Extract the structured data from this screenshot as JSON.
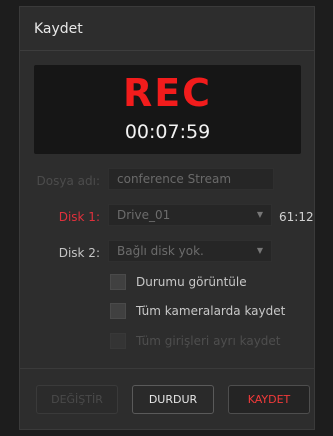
{
  "dialog": {
    "title": "Kaydet"
  },
  "recorder": {
    "status": "REC",
    "duration": "00:07:59"
  },
  "fields": {
    "filename": {
      "label": "Dosya adı:",
      "value": "conference Stream"
    },
    "disk1": {
      "label": "Disk 1:",
      "value": "Drive_01",
      "remaining": "61:12"
    },
    "disk2": {
      "label": "Disk 2:",
      "value": "Bağlı disk yok."
    }
  },
  "options": [
    {
      "label": "Durumu görüntüle",
      "checked": false,
      "enabled": true
    },
    {
      "label": "Tüm kameralarda kaydet",
      "checked": false,
      "enabled": true
    },
    {
      "label": "Tüm girişleri ayrı kaydet",
      "checked": false,
      "enabled": false
    }
  ],
  "buttons": {
    "change": "DEĞİŞTİR",
    "stop": "DURDUR",
    "record": "KAYDET"
  },
  "colors": {
    "rec_red": "#f21c1c",
    "disk_alert_red": "#e0303c",
    "panel": "#2d2d2d"
  }
}
